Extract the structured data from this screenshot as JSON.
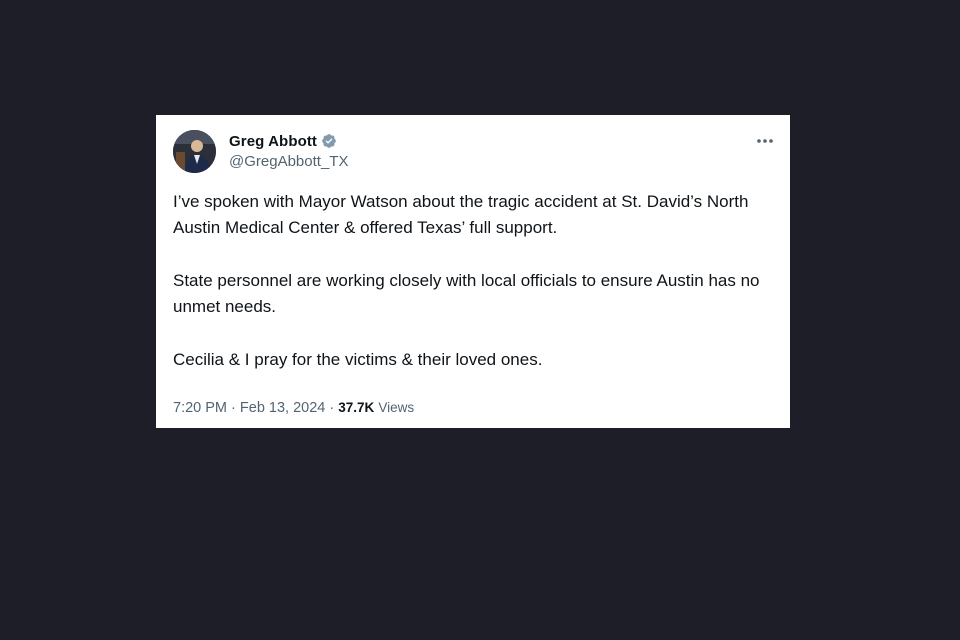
{
  "tweet": {
    "author": {
      "display_name": "Greg Abbott",
      "handle": "@GregAbbott_TX",
      "verified": true,
      "verified_color": "#829aab"
    },
    "paragraphs": [
      "I’ve spoken with Mayor Watson about the tragic accident at St. David’s North Austin Medical Center & offered Texas’ full support.",
      "State personnel are working closely with local officials to ensure Austin has no unmet needs.",
      "Cecilia & I pray for the victims & their loved ones."
    ],
    "time": "7:20 PM",
    "date": "Feb 13, 2024",
    "separator": "·",
    "views_count": "37.7K",
    "views_label": "Views"
  },
  "colors": {
    "background": "#1e1e28",
    "card": "#ffffff",
    "primary_text": "#0f1419",
    "secondary_text": "#536471"
  },
  "icons": {
    "verified": "verified-badge-icon",
    "more": "more-horizontal-icon"
  }
}
